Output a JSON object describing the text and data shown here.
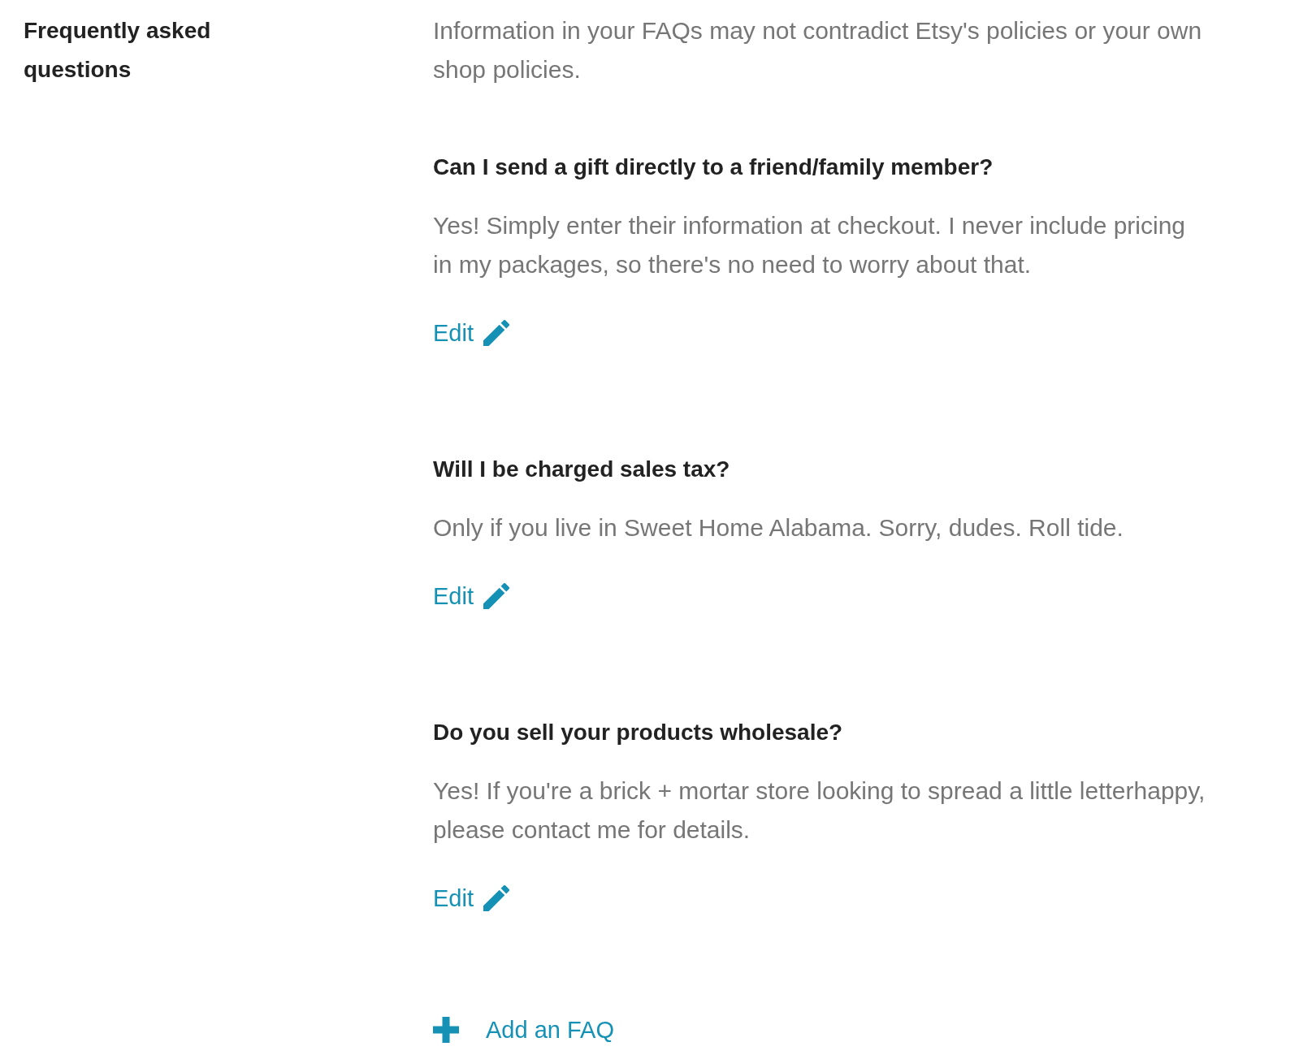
{
  "section": {
    "title": "Frequently asked questions",
    "intro": "Information in your FAQs may not contradict Etsy's policies or your own shop policies."
  },
  "faqs": [
    {
      "question": "Can I send a gift directly to a friend/family member?",
      "answer": "Yes! Simply enter their information at checkout. I never include pricing in my packages, so there's no need to worry about that.",
      "edit_label": "Edit"
    },
    {
      "question": "Will I be charged sales tax?",
      "answer": "Only if you live in Sweet Home Alabama. Sorry, dudes. Roll tide.",
      "edit_label": "Edit"
    },
    {
      "question": "Do you sell your products wholesale?",
      "answer": "Yes! If you're a brick + mortar store looking to spread a little letterhappy, please contact me for details.",
      "edit_label": "Edit"
    }
  ],
  "add_button": {
    "label": "Add an FAQ"
  }
}
